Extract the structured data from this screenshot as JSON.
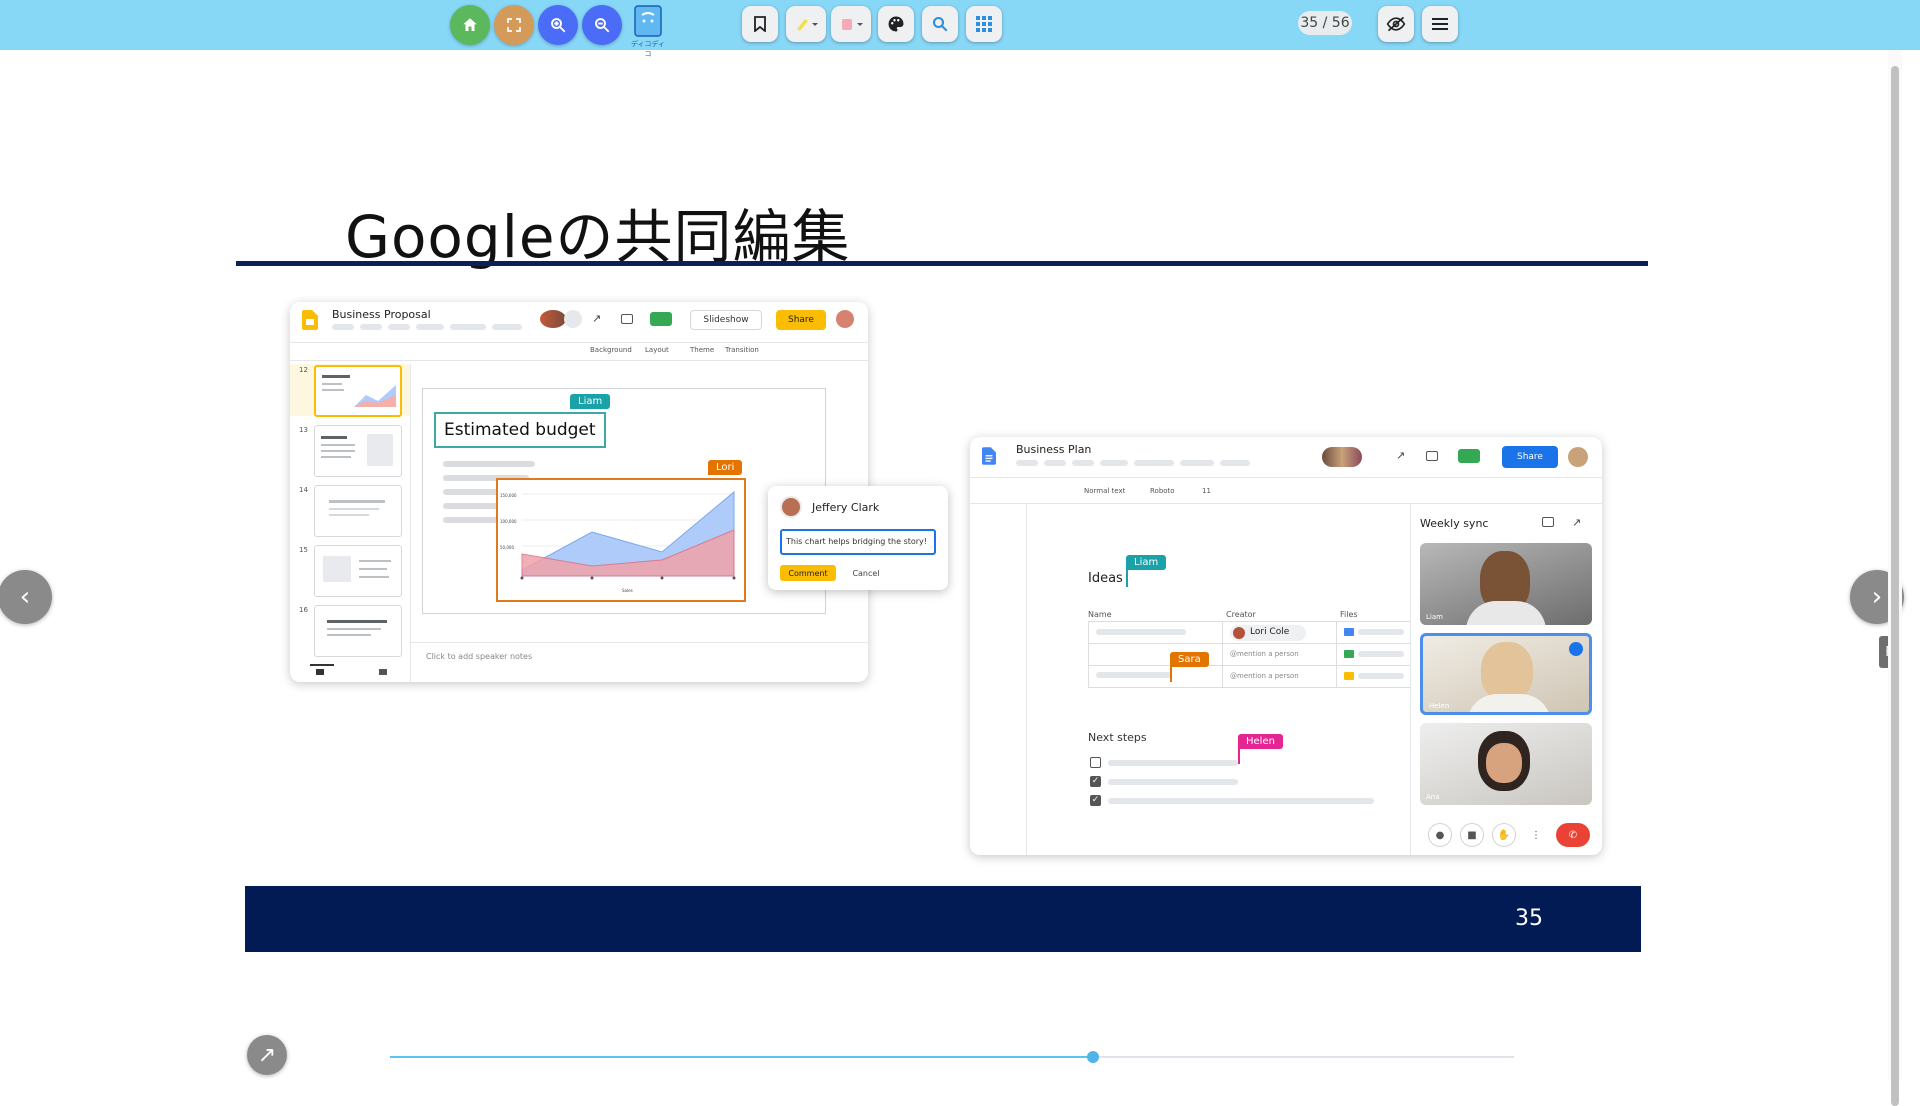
{
  "toolbar": {
    "buttons": [
      {
        "name": "home-icon",
        "color": "#5cb85c"
      },
      {
        "name": "fullscreen-icon",
        "color": "#d49a5a"
      },
      {
        "name": "zoom-in-icon",
        "color": "#4a6cf7"
      },
      {
        "name": "zoom-out-icon",
        "color": "#4a6cf7"
      }
    ],
    "logo_caption": "ディコディコ",
    "tools": [
      "bookmark-icon",
      "highlighter-icon",
      "eraser-icon",
      "palette-icon",
      "search-icon",
      "grid-icon"
    ],
    "page_counter": "35 / 56",
    "right_tools": [
      "hide-icon",
      "menu-icon"
    ]
  },
  "slide": {
    "title": "Googleの共同編集",
    "page_number": "35"
  },
  "slides_app": {
    "doc_title": "Business Proposal",
    "slideshow_label": "Slideshow",
    "share_label": "Share",
    "menu_items": [
      "Background",
      "Layout",
      "Theme",
      "Transition"
    ],
    "thumb_numbers": [
      "12",
      "13",
      "14",
      "15",
      "16"
    ],
    "estimated_budget": "Estimated budget",
    "tag_liam": "Liam",
    "tag_lori": "Lori",
    "chart_y_ticks": [
      "150,000",
      "100,000",
      "50,000"
    ],
    "chart_x_label": "Sales",
    "speaker_notes": "Click to add speaker notes",
    "comment": {
      "name": "Jeffery Clark",
      "text": "This chart helps bridging the story!",
      "comment_label": "Comment",
      "cancel_label": "Cancel"
    }
  },
  "docs_app": {
    "doc_title": "Business Plan",
    "share_label": "Share",
    "toolbar_items": [
      "Normal text",
      "Roboto",
      "11"
    ],
    "heading_ideas": "Ideas",
    "tag_liam": "Liam",
    "columns": [
      "Name",
      "Creator",
      "Files"
    ],
    "creator_chip": "Lori Cole",
    "mention_1": "@mention a person",
    "mention_2": "@mention a person",
    "tag_sara": "Sara",
    "next_steps": "Next steps",
    "tag_helen": "Helen",
    "checklist": [
      false,
      true,
      true
    ],
    "meet_title": "Weekly sync",
    "participants": [
      "Liam",
      "Helen",
      "Ana"
    ]
  },
  "progress": {
    "current": 35,
    "total": 56,
    "fraction": 0.625
  },
  "colors": {
    "toolbar_bg": "#87d7f7",
    "slide_navy": "#021b55",
    "slides_yellow": "#fbbc04",
    "docs_blue": "#1a73e8",
    "tag_teal": "#1ba1a8",
    "tag_orange": "#e37400",
    "tag_pink": "#e52592",
    "end_call_red": "#ea4335"
  }
}
